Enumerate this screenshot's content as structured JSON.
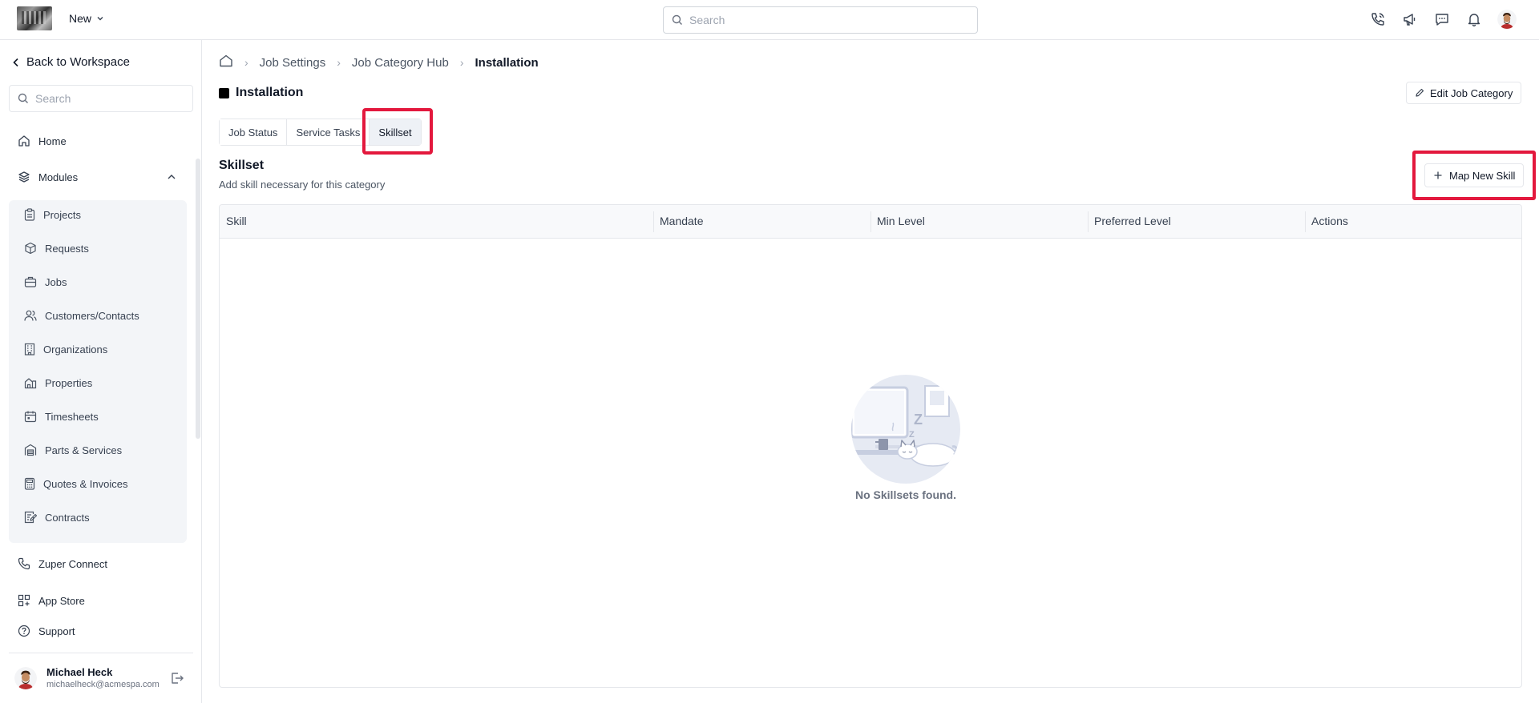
{
  "topbar": {
    "new_label": "New",
    "search_placeholder": "Search",
    "icons": [
      "phone-icon",
      "megaphone-icon",
      "chat-icon",
      "bell-icon",
      "user-avatar"
    ]
  },
  "sidebar": {
    "back_label": "Back to Workspace",
    "search_placeholder": "Search",
    "home_label": "Home",
    "modules_label": "Modules",
    "module_items": [
      {
        "label": "Projects"
      },
      {
        "label": "Requests"
      },
      {
        "label": "Jobs"
      },
      {
        "label": "Customers/Contacts"
      },
      {
        "label": "Organizations"
      },
      {
        "label": "Properties"
      },
      {
        "label": "Timesheets"
      },
      {
        "label": "Parts & Services"
      },
      {
        "label": "Quotes & Invoices"
      },
      {
        "label": "Contracts"
      }
    ],
    "zuper_connect_label": "Zuper Connect",
    "app_store_label": "App Store",
    "support_label": "Support",
    "user": {
      "name": "Michael Heck",
      "email": "michaelheck@acmespa.com"
    }
  },
  "breadcrumb": [
    "Job Settings",
    "Job Category Hub",
    "Installation"
  ],
  "page": {
    "title": "Installation",
    "edit_label": "Edit Job Category"
  },
  "tabs": [
    {
      "label": "Job Status"
    },
    {
      "label": "Service Tasks"
    },
    {
      "label": "Skillset"
    }
  ],
  "section": {
    "title": "Skillset",
    "subtitle": "Add skill necessary for this category",
    "map_label": "Map New Skill"
  },
  "table": {
    "columns": [
      "Skill",
      "Mandate",
      "Min Level",
      "Preferred Level",
      "Actions"
    ],
    "empty_text": "No Skillsets found."
  },
  "colors": {
    "highlight": "#e3183d",
    "accent": "#111827"
  }
}
